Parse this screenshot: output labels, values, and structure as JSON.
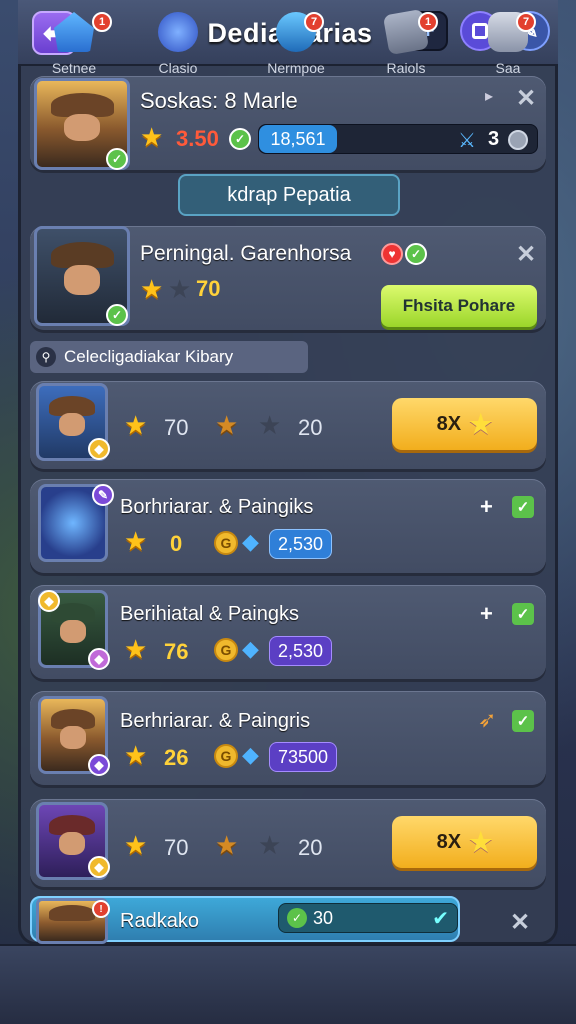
{
  "header": {
    "title": "Dediaalarias",
    "plus_label": "+"
  },
  "cards": [
    {
      "name": "Soskas: 8 Marle",
      "rating": "3.50",
      "progress_text": "18,561",
      "count": "3"
    },
    {
      "name": "Perningal. Garenhorsa",
      "stars_value": "70",
      "action": "Fhsita Pohare"
    }
  ],
  "section_button": "kdrap Pepatia",
  "section_label": "Celecligadiakar Kibary",
  "rows": [
    {
      "type": "stars",
      "v1": "70",
      "v2": "20",
      "button": "8X"
    },
    {
      "type": "hero",
      "name": "Borhriarar. & Paingiks",
      "stars": "0",
      "gems": "2,530",
      "icon": "+"
    },
    {
      "type": "hero",
      "name": "Berihiatal & Paingks",
      "stars": "76",
      "gems": "2,530",
      "icon": "+"
    },
    {
      "type": "hero",
      "name": "Berhriarar. & Paingris",
      "stars": "26",
      "gems": "73500",
      "icon": "➶"
    },
    {
      "type": "stars",
      "v1": "70",
      "v2": "20",
      "button": "8X"
    }
  ],
  "last_row": {
    "name": "Radkako",
    "value": "30"
  },
  "tabs": [
    {
      "label": "Setnee",
      "badge": "1"
    },
    {
      "label": "Clasio",
      "badge": ""
    },
    {
      "label": "Nermpoe",
      "badge": "7"
    },
    {
      "label": "Raiols",
      "badge": "1"
    },
    {
      "label": "Saa",
      "badge": "7"
    }
  ],
  "colors": {
    "accent": "#f2ae1d",
    "panel": "#424c63",
    "gem": "#4fb3ff",
    "success": "#5cc24a"
  }
}
